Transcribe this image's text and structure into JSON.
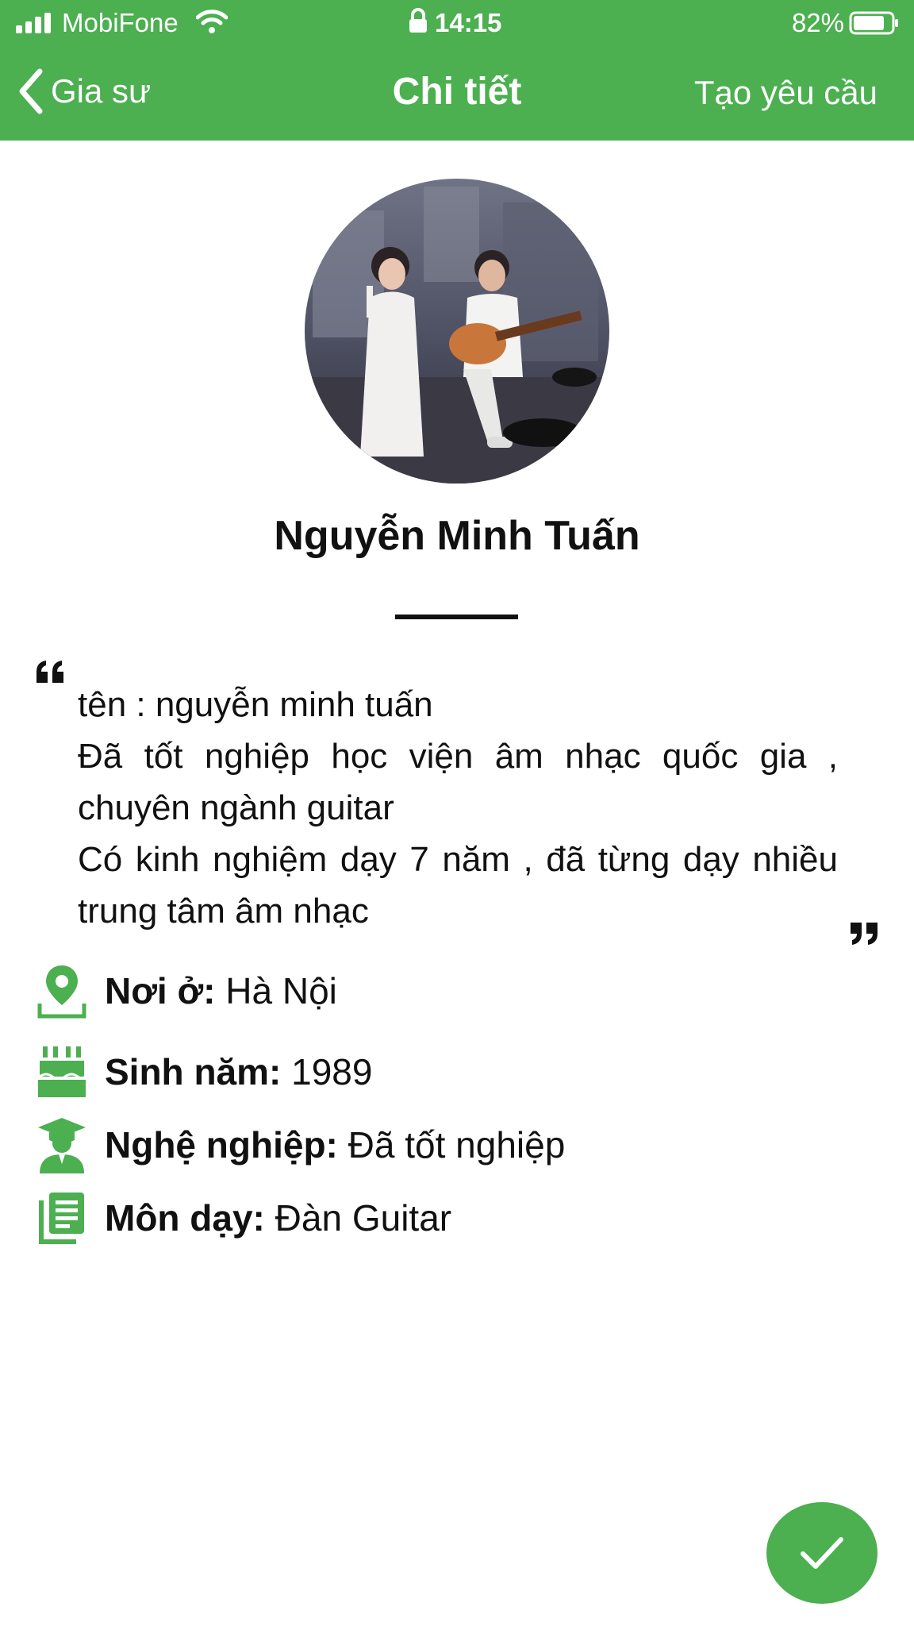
{
  "status_bar": {
    "carrier": "MobiFone",
    "time": "14:15",
    "battery_percent": "82%",
    "battery_level": 0.82
  },
  "nav": {
    "back_label": "Gia sư",
    "title": "Chi tiết",
    "action_label": "Tạo yêu cầu"
  },
  "colors": {
    "accent": "#4caf50"
  },
  "profile": {
    "name": "Nguyễn Minh Tuấn",
    "bio_lines": [
      "tên : nguyễn minh tuấn",
      "Đã tốt nghiệp học viện âm nhạc quốc gia , chuyên ngành guitar",
      "Có kinh nghiệm dạy 7 năm , đã từng dạy nhiều trung tâm âm nhạc"
    ],
    "details": [
      {
        "icon": "location-pin-icon",
        "label": "Nơi ở:",
        "value": "Hà Nội"
      },
      {
        "icon": "birthday-cake-icon",
        "label": "Sinh năm:",
        "value": "1989"
      },
      {
        "icon": "graduate-icon",
        "label": "Nghệ nghiệp:",
        "value": "Đã tốt nghiệp"
      },
      {
        "icon": "subject-book-icon",
        "label": "Môn dạy:",
        "value": "Đàn Guitar"
      }
    ]
  },
  "fab": {
    "icon": "checkmark-icon"
  }
}
